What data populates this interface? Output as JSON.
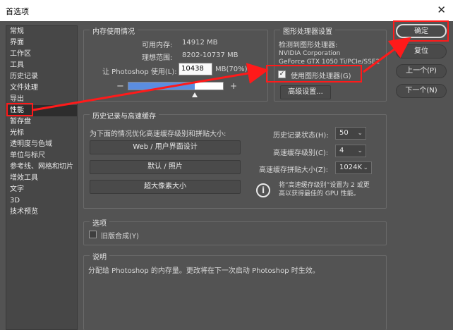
{
  "window": {
    "title": "首选项",
    "close_glyph": "✕"
  },
  "sidebar": {
    "items": [
      {
        "label": "常规"
      },
      {
        "label": "界面"
      },
      {
        "label": "工作区"
      },
      {
        "label": "工具"
      },
      {
        "label": "历史记录"
      },
      {
        "label": "文件处理"
      },
      {
        "label": "导出"
      },
      {
        "label": "性能"
      },
      {
        "label": "暂存盘"
      },
      {
        "label": "光标"
      },
      {
        "label": "透明度与色域"
      },
      {
        "label": "单位与标尺"
      },
      {
        "label": "参考线、网格和切片"
      },
      {
        "label": "增效工具"
      },
      {
        "label": "文字"
      },
      {
        "label": "3D"
      },
      {
        "label": "技术预览"
      }
    ],
    "active_index": 7
  },
  "memory": {
    "title": "内存使用情况",
    "available_label": "可用内存:",
    "available_value": "14912 MB",
    "ideal_label": "理想范围:",
    "ideal_value": "8202-10737 MB",
    "usage_label": "让 Photoshop 使用(L):",
    "usage_value": "10438",
    "usage_suffix": "MB(70%)",
    "minus": "−",
    "plus": "+",
    "fill_fraction": 0.7
  },
  "gpu": {
    "title": "图形处理器设置",
    "detected_label": "检测到图形处理器:",
    "vendor": "NVIDIA Corporation",
    "model": "GeForce GTX 1050 Ti/PCIe/SSE2",
    "use_gpu_label": "使用图形处理器(G)",
    "use_gpu_checked": true,
    "advanced_button": "高级设置..."
  },
  "history": {
    "title": "历史记录与高速缓存",
    "optimize_label": "为下面的情况优化高速缓存级别和拼贴大小:",
    "buttons": [
      "Web / 用户界面设计",
      "默认 / 照片",
      "超大像素大小"
    ],
    "states_label": "历史记录状态(H):",
    "states_value": "50",
    "levels_label": "高速缓存级别(C):",
    "levels_value": "4",
    "tile_label": "高速缓存拼贴大小(Z):",
    "tile_value": "1024K",
    "info_line1": "将“高速缓存级别”设置为 2 或更",
    "info_line2": "高以获得最佳的 GPU 性能。"
  },
  "options": {
    "title": "选项",
    "legacy_label": "旧版合成(Y)",
    "legacy_checked": false
  },
  "description": {
    "title": "说明",
    "text": "分配给 Photoshop 的内存量。更改将在下一次启动 Photoshop 时生效。"
  },
  "buttons": {
    "ok": "确定",
    "reset": "复位",
    "prev": "上一个(P)",
    "next": "下一个(N)"
  },
  "colors": {
    "accent": "#ff1a1a",
    "memory_fill": "#5b8de0",
    "dialog_bg": "#535353"
  }
}
